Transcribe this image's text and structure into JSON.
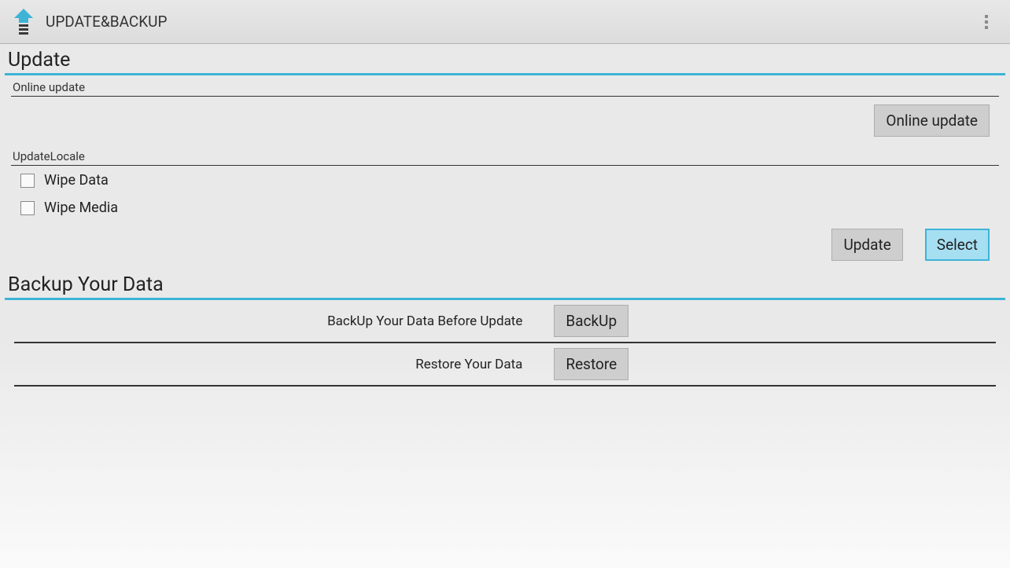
{
  "actionbar": {
    "title": "UPDATE&BACKUP"
  },
  "update": {
    "heading": "Update",
    "online_sub": "Online update",
    "online_btn": "Online update",
    "locale_sub": "UpdateLocale",
    "wipe_data_label": "Wipe Data",
    "wipe_media_label": "Wipe Media",
    "update_btn": "Update",
    "select_btn": "Select"
  },
  "backup": {
    "heading": "Backup Your Data",
    "backup_text": "BackUp Your Data Before Update",
    "backup_btn": "BackUp",
    "restore_text": "Restore Your Data",
    "restore_btn": "Restore"
  }
}
